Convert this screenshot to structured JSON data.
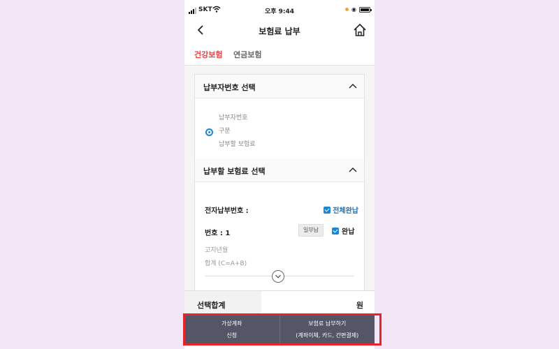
{
  "status_bar": {
    "carrier": "SKT",
    "time": "오후 9:44"
  },
  "header": {
    "title": "보험료 납부",
    "back_icon": "chevron-left-icon",
    "home_icon": "home-icon"
  },
  "tabs": [
    {
      "label": "건강보험",
      "active": true
    },
    {
      "label": "연금보험",
      "active": false
    }
  ],
  "section_payer": {
    "title": "납부자번호 선택",
    "fields": [
      "납부자번호",
      "구분",
      "납부할 보험료"
    ]
  },
  "section_premium": {
    "title": "납부할 보험료 선택",
    "e_pay_number_label": "전자납부번호 :",
    "select_all_label": "전체완납",
    "item_number_label": "번호 : 1",
    "partial_button": "일부납",
    "full_pay_label": "완납",
    "notice_month_label": "고지년월",
    "sum_label": "합계 (C=A+B)"
  },
  "total": {
    "label": "선택합계",
    "unit": "원"
  },
  "bottom_buttons": {
    "virtual_account_line1": "가상계좌",
    "virtual_account_line2": "신청",
    "pay_line1": "보험료 납부하기",
    "pay_line2": "(계좌이체, 카드, 간편결제)"
  },
  "colors": {
    "active_tab": "#e44545",
    "check_blue": "#1b86d8",
    "button_bar": "#545566",
    "highlight": "#e8232a"
  }
}
